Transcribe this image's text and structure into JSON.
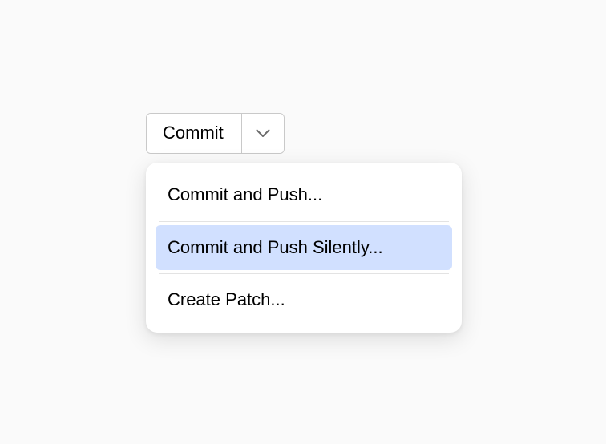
{
  "button": {
    "main_label": "Commit"
  },
  "menu": {
    "items": [
      {
        "label": "Commit and Push...",
        "selected": false
      },
      {
        "label": "Commit and Push Silently...",
        "selected": true
      },
      {
        "label": "Create Patch...",
        "selected": false
      }
    ]
  }
}
